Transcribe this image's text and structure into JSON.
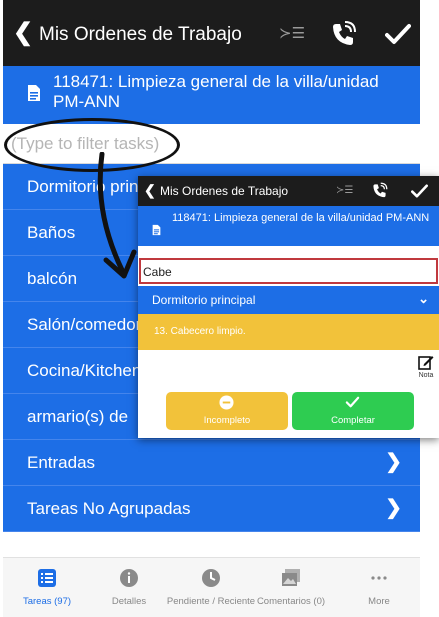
{
  "header": {
    "back_glyph": "❮",
    "title": "Mis Ordenes de Trabajo",
    "filter_glyph": "≻☰",
    "icons": [
      "back-arrow",
      "list-filter",
      "phone-call",
      "checkmark"
    ]
  },
  "order": {
    "label": "118471: Limpieza general de la villa/unidad PM-ANN"
  },
  "filter": {
    "placeholder": "(Type to filter tasks)",
    "value": ""
  },
  "groups": [
    {
      "label": "Dormitorio principal"
    },
    {
      "label": "Baños"
    },
    {
      "label": "balcón"
    },
    {
      "label": "Salón/comedor"
    },
    {
      "label": "Cocina/Kitchen"
    },
    {
      "label": "armario(s) de"
    },
    {
      "label": "Entradas"
    },
    {
      "label": "Tareas No Agrupadas"
    }
  ],
  "chevron_glyph": "❯",
  "tabs": [
    {
      "label": "Tareas (97)",
      "icon": "list-icon",
      "active": true
    },
    {
      "label": "Detalles",
      "icon": "info-icon",
      "active": false
    },
    {
      "label": "Pendiente / Reciente",
      "icon": "clock-icon",
      "active": false
    },
    {
      "label": "Comentarios (0)",
      "icon": "images-icon",
      "active": false
    },
    {
      "label": "More",
      "icon": "more-icon",
      "active": false
    }
  ],
  "popup": {
    "back_glyph": "❮",
    "title": "Mis Ordenes de Trabajo",
    "filter_glyph": "≻☰",
    "order_label": "118471: Limpieza general de la villa/unidad PM-ANN",
    "filter_value": "Cabe",
    "group_label": "Dormitorio principal",
    "group_chevron": "⌄",
    "task_label": "13. Cabecero limpio.",
    "note_label": "Nota",
    "incomplete_label": "Incompleto",
    "complete_label": "Completar"
  },
  "colors": {
    "accent_blue": "#1d6ee6",
    "bar_dark": "#1c1c1c",
    "task_yellow": "#f2c23a",
    "complete_green": "#2ecc51",
    "input_focus_red": "#c0393e"
  }
}
